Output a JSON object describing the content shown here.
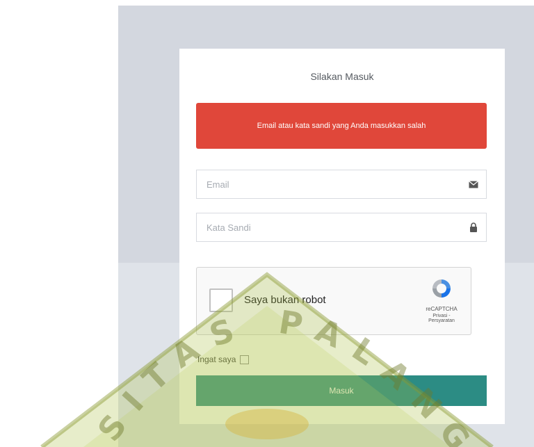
{
  "login": {
    "title": "Silakan Masuk",
    "error_message": "Email atau kata sandi yang Anda masukkan salah",
    "email_placeholder": "Email",
    "password_placeholder": "Kata Sandi",
    "remember_label": "Ingat saya",
    "submit_label": "Masuk"
  },
  "recaptcha": {
    "label": "Saya bukan robot",
    "brand": "reCAPTCHA",
    "links": "Privasi - Persyaratan"
  },
  "watermark": {
    "text": "SITAS PALANGK"
  },
  "colors": {
    "alert": "#e0473a",
    "submit": "#2c8c84",
    "background": "#d3d7df",
    "watermark": "#9fb83a"
  },
  "icons": {
    "email": "envelope-icon",
    "password": "lock-icon",
    "recaptcha": "recaptcha-logo-icon"
  }
}
